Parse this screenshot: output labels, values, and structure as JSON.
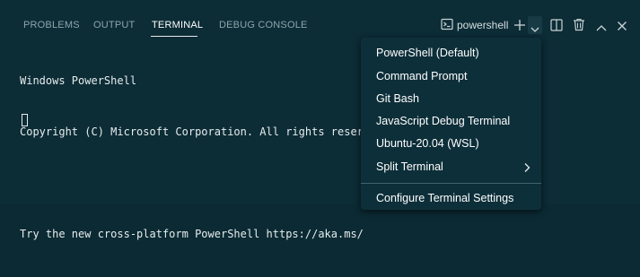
{
  "tabs": [
    {
      "label": "PROBLEMS",
      "active": false
    },
    {
      "label": "OUTPUT",
      "active": false
    },
    {
      "label": "TERMINAL",
      "active": true
    },
    {
      "label": "DEBUG CONSOLE",
      "active": false
    }
  ],
  "toolbar": {
    "terminal_name": "powershell",
    "icons": [
      "terminal-icon",
      "plus-icon",
      "chevron-down-icon",
      "split-icon",
      "trash-icon",
      "chevron-up-icon",
      "close-icon"
    ]
  },
  "terminal": {
    "lines": [
      "Windows PowerShell",
      "Copyright (C) Microsoft Corporation. All rights reser",
      "",
      "Try the new cross-platform PowerShell https://aka.ms/"
    ]
  },
  "menu": {
    "items": [
      {
        "label": "PowerShell (Default)"
      },
      {
        "label": "Command Prompt"
      },
      {
        "label": "Git Bash"
      },
      {
        "label": "JavaScript Debug Terminal"
      },
      {
        "label": "Ubuntu-20.04 (WSL)"
      },
      {
        "label": "Split Terminal",
        "submenu": true
      }
    ],
    "footer_item": {
      "label": "Configure Terminal Settings"
    }
  },
  "colors": {
    "background": "#0c2c36",
    "menu_background": "#0d2f3a",
    "text": "#e6eced",
    "inactive_tab": "#8ea5ab"
  }
}
